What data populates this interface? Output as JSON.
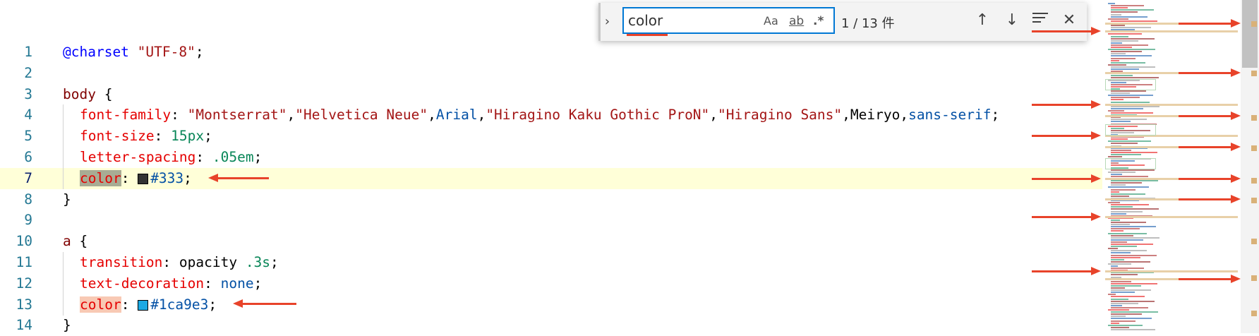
{
  "find": {
    "query": "color",
    "match_case": "Aa",
    "whole_word": "ab",
    "regex": ".*",
    "count": "1 / 13 件"
  },
  "editor": {
    "current_line": 7,
    "lines": [
      {
        "n": "1",
        "tokens": [
          [
            "c-at",
            "@charset"
          ],
          [
            "c-plain",
            " "
          ],
          [
            "c-str",
            "\"UTF-8\""
          ],
          [
            "c-plain",
            ";"
          ]
        ]
      },
      {
        "n": "2",
        "tokens": []
      },
      {
        "n": "3",
        "tokens": [
          [
            "c-sel",
            "body"
          ],
          [
            "c-plain",
            " {"
          ]
        ]
      },
      {
        "n": "4",
        "indent": true,
        "tokens": [
          [
            "c-prop",
            "font-family"
          ],
          [
            "c-plain",
            ": "
          ],
          [
            "c-str",
            "\"Montserrat\""
          ],
          [
            "c-plain",
            ","
          ],
          [
            "c-str",
            "\"Helvetica Neue\""
          ],
          [
            "c-plain",
            ","
          ],
          [
            "c-val",
            "Arial"
          ],
          [
            "c-plain",
            ","
          ],
          [
            "c-str",
            "\"Hiragino Kaku Gothic ProN\""
          ],
          [
            "c-plain",
            ","
          ],
          [
            "c-str",
            "\"Hiragino Sans\""
          ],
          [
            "c-plain",
            ",Meiryo,"
          ],
          [
            "c-val",
            "sans-serif"
          ],
          [
            "c-plain",
            ";"
          ]
        ]
      },
      {
        "n": "5",
        "indent": true,
        "tokens": [
          [
            "c-prop",
            "font-size"
          ],
          [
            "c-plain",
            ": "
          ],
          [
            "c-num",
            "15px"
          ],
          [
            "c-plain",
            ";"
          ]
        ]
      },
      {
        "n": "6",
        "indent": true,
        "tokens": [
          [
            "c-prop",
            "letter-spacing"
          ],
          [
            "c-plain",
            ": "
          ],
          [
            "c-num",
            ".05em"
          ],
          [
            "c-plain",
            ";"
          ]
        ]
      },
      {
        "n": "7",
        "indent": true,
        "tokens": [
          [
            "c-prop match-current",
            "color"
          ],
          [
            "c-plain",
            ": "
          ],
          [
            "swatch",
            "#333333"
          ],
          [
            "c-val",
            "#333"
          ],
          [
            "c-plain",
            ";"
          ]
        ]
      },
      {
        "n": "8",
        "tokens": [
          [
            "c-plain",
            "}"
          ]
        ]
      },
      {
        "n": "9",
        "tokens": []
      },
      {
        "n": "10",
        "tokens": [
          [
            "c-sel",
            "a"
          ],
          [
            "c-plain",
            " {"
          ]
        ]
      },
      {
        "n": "11",
        "indent": true,
        "tokens": [
          [
            "c-prop",
            "transition"
          ],
          [
            "c-plain",
            ": opacity "
          ],
          [
            "c-num",
            ".3s"
          ],
          [
            "c-plain",
            ";"
          ]
        ]
      },
      {
        "n": "12",
        "indent": true,
        "tokens": [
          [
            "c-prop",
            "text-decoration"
          ],
          [
            "c-plain",
            ": "
          ],
          [
            "c-val",
            "none"
          ],
          [
            "c-plain",
            ";"
          ]
        ]
      },
      {
        "n": "13",
        "indent": true,
        "tokens": [
          [
            "c-prop match-other",
            "color"
          ],
          [
            "c-plain",
            ": "
          ],
          [
            "swatch",
            "#1ca9e3"
          ],
          [
            "c-val",
            "#1ca9e3"
          ],
          [
            "c-plain",
            ";"
          ]
        ]
      },
      {
        "n": "14",
        "tokens": [
          [
            "c-plain",
            "}"
          ]
        ]
      }
    ]
  },
  "colors": {
    "arrow": "#e8432a",
    "current_line_bg": "#ffffd8",
    "find_border": "#0078d4"
  }
}
